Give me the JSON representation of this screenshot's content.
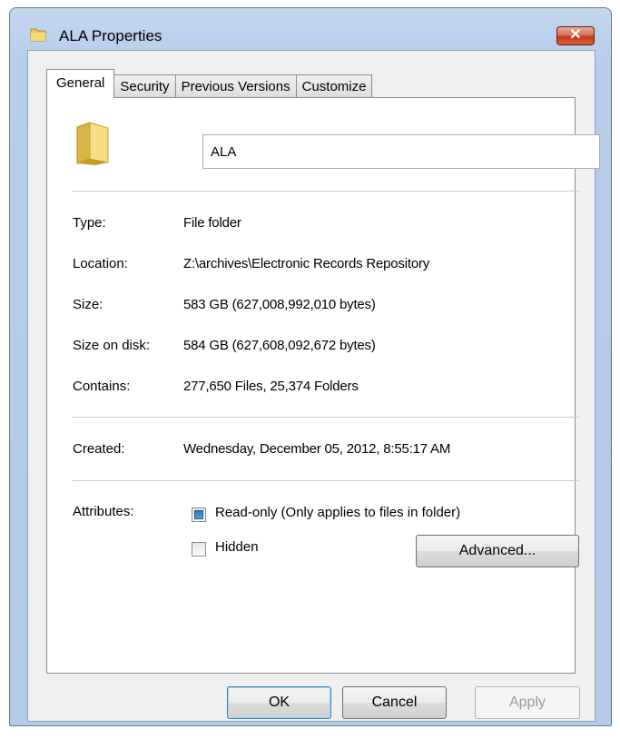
{
  "window": {
    "title": "ALA Properties",
    "close_label": "✕"
  },
  "tabs": [
    {
      "label": "General",
      "active": true
    },
    {
      "label": "Security",
      "active": false
    },
    {
      "label": "Previous Versions",
      "active": false
    },
    {
      "label": "Customize",
      "active": false
    }
  ],
  "general": {
    "name_value": "ALA",
    "properties": [
      {
        "label": "Type:",
        "value": "File folder"
      },
      {
        "label": "Location:",
        "value": "Z:\\archives\\Electronic Records Repository"
      },
      {
        "label": "Size:",
        "value": "583 GB (627,008,992,010 bytes)"
      },
      {
        "label": "Size on disk:",
        "value": "584 GB (627,608,092,672 bytes)"
      },
      {
        "label": "Contains:",
        "value": "277,650 Files, 25,374 Folders"
      }
    ],
    "created": {
      "label": "Created:",
      "value": "Wednesday, December 05, 2012, 8:55:17 AM"
    },
    "attributes": {
      "label": "Attributes:",
      "readonly_label": "Read-only (Only applies to files in folder)",
      "readonly_state": "indeterminate",
      "hidden_label": "Hidden",
      "hidden_checked": false,
      "advanced_label": "Advanced..."
    }
  },
  "buttons": {
    "ok": "OK",
    "cancel": "Cancel",
    "apply": "Apply"
  },
  "colors": {
    "frame": "#b9cee9",
    "readonly_fill": "#2c7ab9"
  }
}
